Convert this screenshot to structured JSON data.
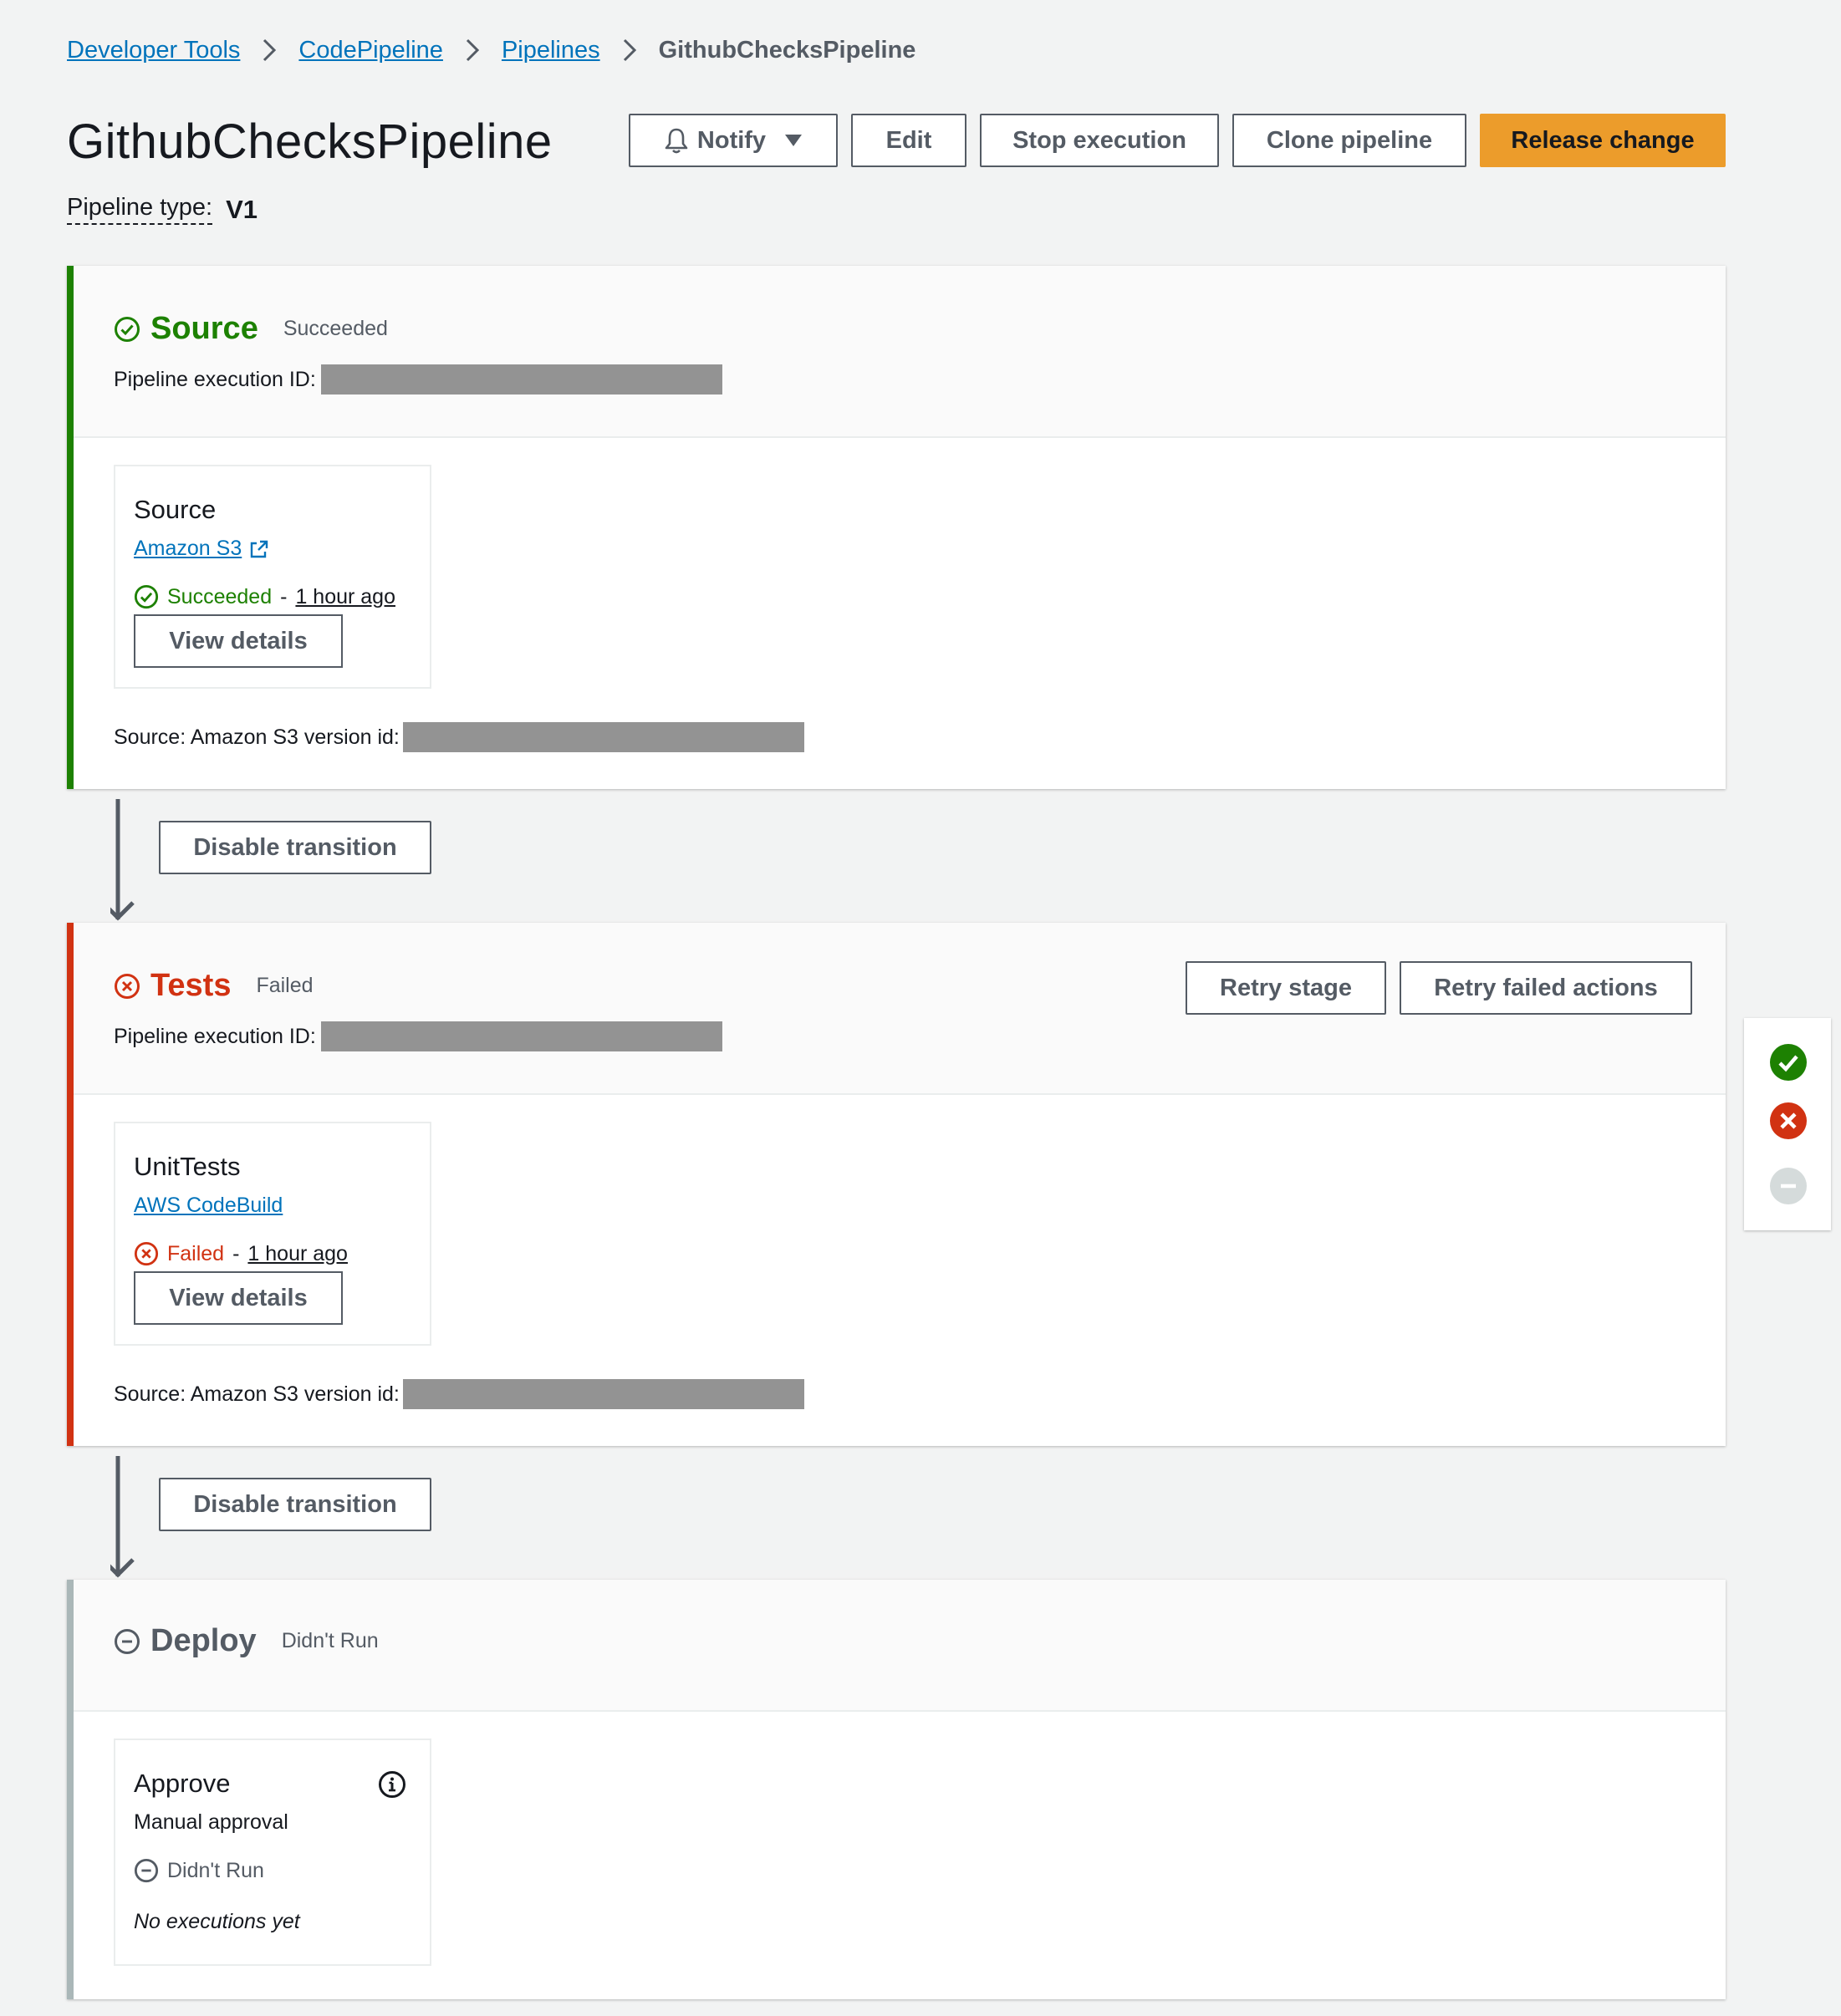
{
  "breadcrumb": {
    "items": [
      "Developer Tools",
      "CodePipeline",
      "Pipelines"
    ],
    "current": "GithubChecksPipeline"
  },
  "header": {
    "title": "GithubChecksPipeline",
    "pipeline_type_label": "Pipeline type:",
    "pipeline_type_value": "V1",
    "buttons": {
      "notify": "Notify",
      "edit": "Edit",
      "stop": "Stop execution",
      "clone": "Clone pipeline",
      "release": "Release change"
    }
  },
  "stages": [
    {
      "name": "Source",
      "status": "Succeeded",
      "exec_label": "Pipeline execution ID:",
      "action": {
        "name": "Source",
        "provider": "Amazon S3",
        "status": "Succeeded",
        "time": "1 hour ago",
        "button": "View details"
      },
      "source_label": "Source: Amazon S3 version id:"
    },
    {
      "name": "Tests",
      "status": "Failed",
      "exec_label": "Pipeline execution ID:",
      "retry_stage": "Retry stage",
      "retry_failed": "Retry failed actions",
      "action": {
        "name": "UnitTests",
        "provider": "AWS CodeBuild",
        "status": "Failed",
        "time": "1 hour ago",
        "button": "View details"
      },
      "source_label": "Source: Amazon S3 version id:"
    },
    {
      "name": "Deploy",
      "status": "Didn't Run",
      "action": {
        "name": "Approve",
        "provider": "Manual approval",
        "status": "Didn't Run",
        "note": "No executions yet"
      }
    }
  ],
  "transitions": {
    "button": "Disable transition"
  },
  "colors": {
    "success": "#1d8102",
    "failed": "#d13212",
    "disabled": "#aab7b8",
    "primary": "#ec9c2b",
    "link": "#0073bb"
  },
  "legend": {
    "icons": [
      "success-icon",
      "failed-icon",
      "didnt-run-icon"
    ]
  }
}
